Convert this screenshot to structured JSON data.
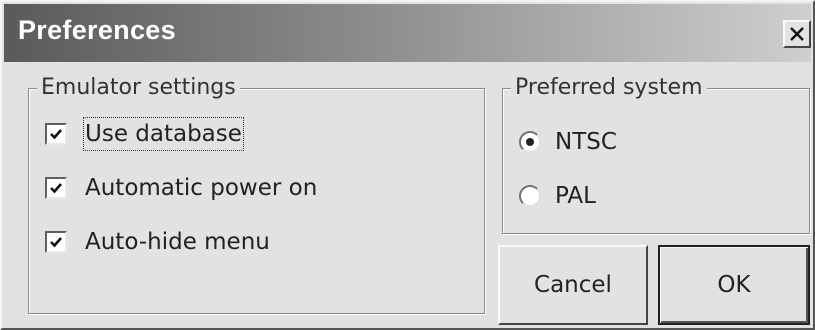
{
  "dialog": {
    "title": "Preferences",
    "close_glyph": "close-icon"
  },
  "emulator_settings": {
    "legend": "Emulator settings",
    "options": [
      {
        "label": "Use database",
        "checked": true,
        "focused": true
      },
      {
        "label": "Automatic power on",
        "checked": true
      },
      {
        "label": "Auto-hide menu",
        "checked": true
      }
    ]
  },
  "preferred_system": {
    "legend": "Preferred system",
    "options": [
      {
        "label": "NTSC",
        "selected": true
      },
      {
        "label": "PAL",
        "selected": false
      }
    ]
  },
  "buttons": {
    "cancel_label": "Cancel",
    "ok_label": "OK"
  },
  "colors": {
    "titlebar_start": "#5a5a5a",
    "titlebar_end": "#cfcfcf",
    "face": "#e2e2e2"
  }
}
